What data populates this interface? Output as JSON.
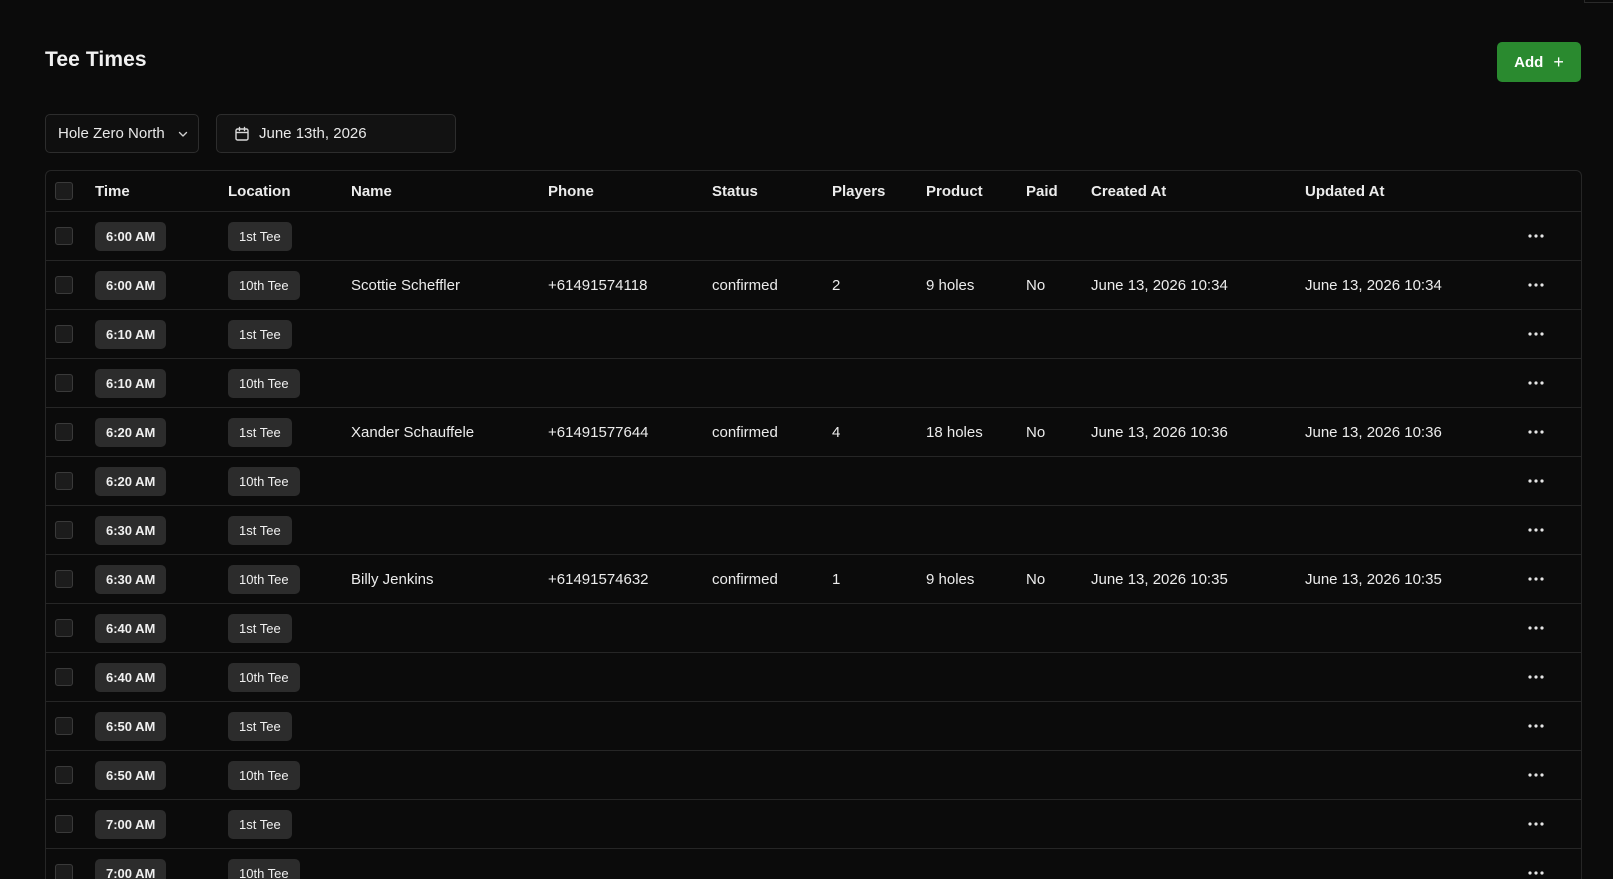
{
  "page": {
    "title": "Tee Times",
    "add_label": "Add",
    "add_icon": "plus-icon"
  },
  "filters": {
    "course": "Hole Zero North",
    "date": "June 13th, 2026"
  },
  "table": {
    "columns": [
      "Time",
      "Location",
      "Name",
      "Phone",
      "Status",
      "Players",
      "Product",
      "Paid",
      "Created At",
      "Updated At"
    ],
    "rows": [
      {
        "time": "6:00 AM",
        "location": "1st Tee",
        "name": "",
        "phone": "",
        "status": "",
        "players": "",
        "product": "",
        "paid": "",
        "created_at": "",
        "updated_at": ""
      },
      {
        "time": "6:00 AM",
        "location": "10th Tee",
        "name": "Scottie Scheffler",
        "phone": "+61491574118",
        "status": "confirmed",
        "players": "2",
        "product": "9 holes",
        "paid": "No",
        "created_at": "June 13, 2026 10:34",
        "updated_at": "June 13, 2026 10:34"
      },
      {
        "time": "6:10 AM",
        "location": "1st Tee",
        "name": "",
        "phone": "",
        "status": "",
        "players": "",
        "product": "",
        "paid": "",
        "created_at": "",
        "updated_at": ""
      },
      {
        "time": "6:10 AM",
        "location": "10th Tee",
        "name": "",
        "phone": "",
        "status": "",
        "players": "",
        "product": "",
        "paid": "",
        "created_at": "",
        "updated_at": ""
      },
      {
        "time": "6:20 AM",
        "location": "1st Tee",
        "name": "Xander Schauffele",
        "phone": "+61491577644",
        "status": "confirmed",
        "players": "4",
        "product": "18 holes",
        "paid": "No",
        "created_at": "June 13, 2026 10:36",
        "updated_at": "June 13, 2026 10:36"
      },
      {
        "time": "6:20 AM",
        "location": "10th Tee",
        "name": "",
        "phone": "",
        "status": "",
        "players": "",
        "product": "",
        "paid": "",
        "created_at": "",
        "updated_at": ""
      },
      {
        "time": "6:30 AM",
        "location": "1st Tee",
        "name": "",
        "phone": "",
        "status": "",
        "players": "",
        "product": "",
        "paid": "",
        "created_at": "",
        "updated_at": ""
      },
      {
        "time": "6:30 AM",
        "location": "10th Tee",
        "name": "Billy Jenkins",
        "phone": "+61491574632",
        "status": "confirmed",
        "players": "1",
        "product": "9 holes",
        "paid": "No",
        "created_at": "June 13, 2026 10:35",
        "updated_at": "June 13, 2026 10:35"
      },
      {
        "time": "6:40 AM",
        "location": "1st Tee",
        "name": "",
        "phone": "",
        "status": "",
        "players": "",
        "product": "",
        "paid": "",
        "created_at": "",
        "updated_at": ""
      },
      {
        "time": "6:40 AM",
        "location": "10th Tee",
        "name": "",
        "phone": "",
        "status": "",
        "players": "",
        "product": "",
        "paid": "",
        "created_at": "",
        "updated_at": ""
      },
      {
        "time": "6:50 AM",
        "location": "1st Tee",
        "name": "",
        "phone": "",
        "status": "",
        "players": "",
        "product": "",
        "paid": "",
        "created_at": "",
        "updated_at": ""
      },
      {
        "time": "6:50 AM",
        "location": "10th Tee",
        "name": "",
        "phone": "",
        "status": "",
        "players": "",
        "product": "",
        "paid": "",
        "created_at": "",
        "updated_at": ""
      },
      {
        "time": "7:00 AM",
        "location": "1st Tee",
        "name": "",
        "phone": "",
        "status": "",
        "players": "",
        "product": "",
        "paid": "",
        "created_at": "",
        "updated_at": ""
      },
      {
        "time": "7:00 AM",
        "location": "10th Tee",
        "name": "",
        "phone": "",
        "status": "",
        "players": "",
        "product": "",
        "paid": "",
        "created_at": "",
        "updated_at": ""
      }
    ]
  },
  "icons": {
    "course_select": "chevron-down-icon",
    "date_picker": "calendar-icon",
    "row_actions": "more-horizontal-icon"
  },
  "colors": {
    "background": "#0b0b0b",
    "accent": "#2a8a2f",
    "badge": "#2c2c2c",
    "border": "#262626"
  }
}
